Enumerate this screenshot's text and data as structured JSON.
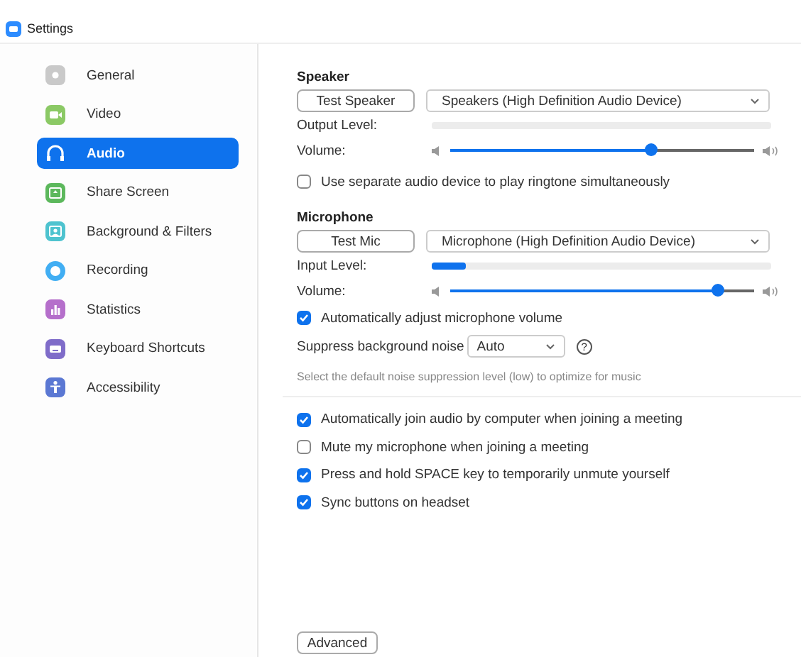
{
  "window": {
    "title": "Settings"
  },
  "sidebar": {
    "items": [
      {
        "label": "General",
        "kind": "gear",
        "color": "#c9c9c9",
        "selected": false
      },
      {
        "label": "Video",
        "kind": "camera",
        "color": "#8bc965",
        "selected": false
      },
      {
        "label": "Audio",
        "kind": "headphones",
        "color": "#ffffff",
        "selected": true
      },
      {
        "label": "Share Screen",
        "kind": "share",
        "color": "#5cb85c",
        "selected": false
      },
      {
        "label": "Background & Filters",
        "kind": "portrait",
        "color": "#4ec3cf",
        "selected": false
      },
      {
        "label": "Recording",
        "kind": "record",
        "color": "#41aef3",
        "selected": false
      },
      {
        "label": "Statistics",
        "kind": "bars",
        "color": "#b56fcb",
        "selected": false
      },
      {
        "label": "Keyboard Shortcuts",
        "kind": "keyboard",
        "color": "#7f6cc9",
        "selected": false
      },
      {
        "label": "Accessibility",
        "kind": "figure",
        "color": "#5b78d3",
        "selected": false
      }
    ]
  },
  "speaker": {
    "heading": "Speaker",
    "test_button": "Test Speaker",
    "device": "Speakers (High Definition Audio Device)",
    "output_label": "Output Level:",
    "output_level": {
      "level": 0
    },
    "volume_label": "Volume:",
    "volume": {
      "level": 0.66
    }
  },
  "ringtone": {
    "label": "Use separate audio device to play ringtone simultaneously",
    "checked": false
  },
  "microphone": {
    "heading": "Microphone",
    "test_button": "Test Mic",
    "device": "Microphone (High Definition Audio Device)",
    "input_label": "Input Level:",
    "input_level": {
      "level": 0.1
    },
    "volume_label": "Volume:",
    "volume": {
      "level": 0.88
    }
  },
  "auto_adjust": {
    "label": "Automatically adjust microphone volume",
    "checked": true
  },
  "suppress": {
    "label": "Suppress background noise",
    "value": "Auto",
    "help": "?",
    "hint": "Select the default noise suppression level (low) to optimize for music"
  },
  "options": [
    {
      "label": "Automatically join audio by computer when joining a meeting",
      "checked": true
    },
    {
      "label": "Mute my microphone when joining a meeting",
      "checked": false
    },
    {
      "label": "Press and hold SPACE key to temporarily unmute yourself",
      "checked": true
    },
    {
      "label": "Sync buttons on headset",
      "checked": true
    }
  ],
  "advanced_button": "Advanced"
}
